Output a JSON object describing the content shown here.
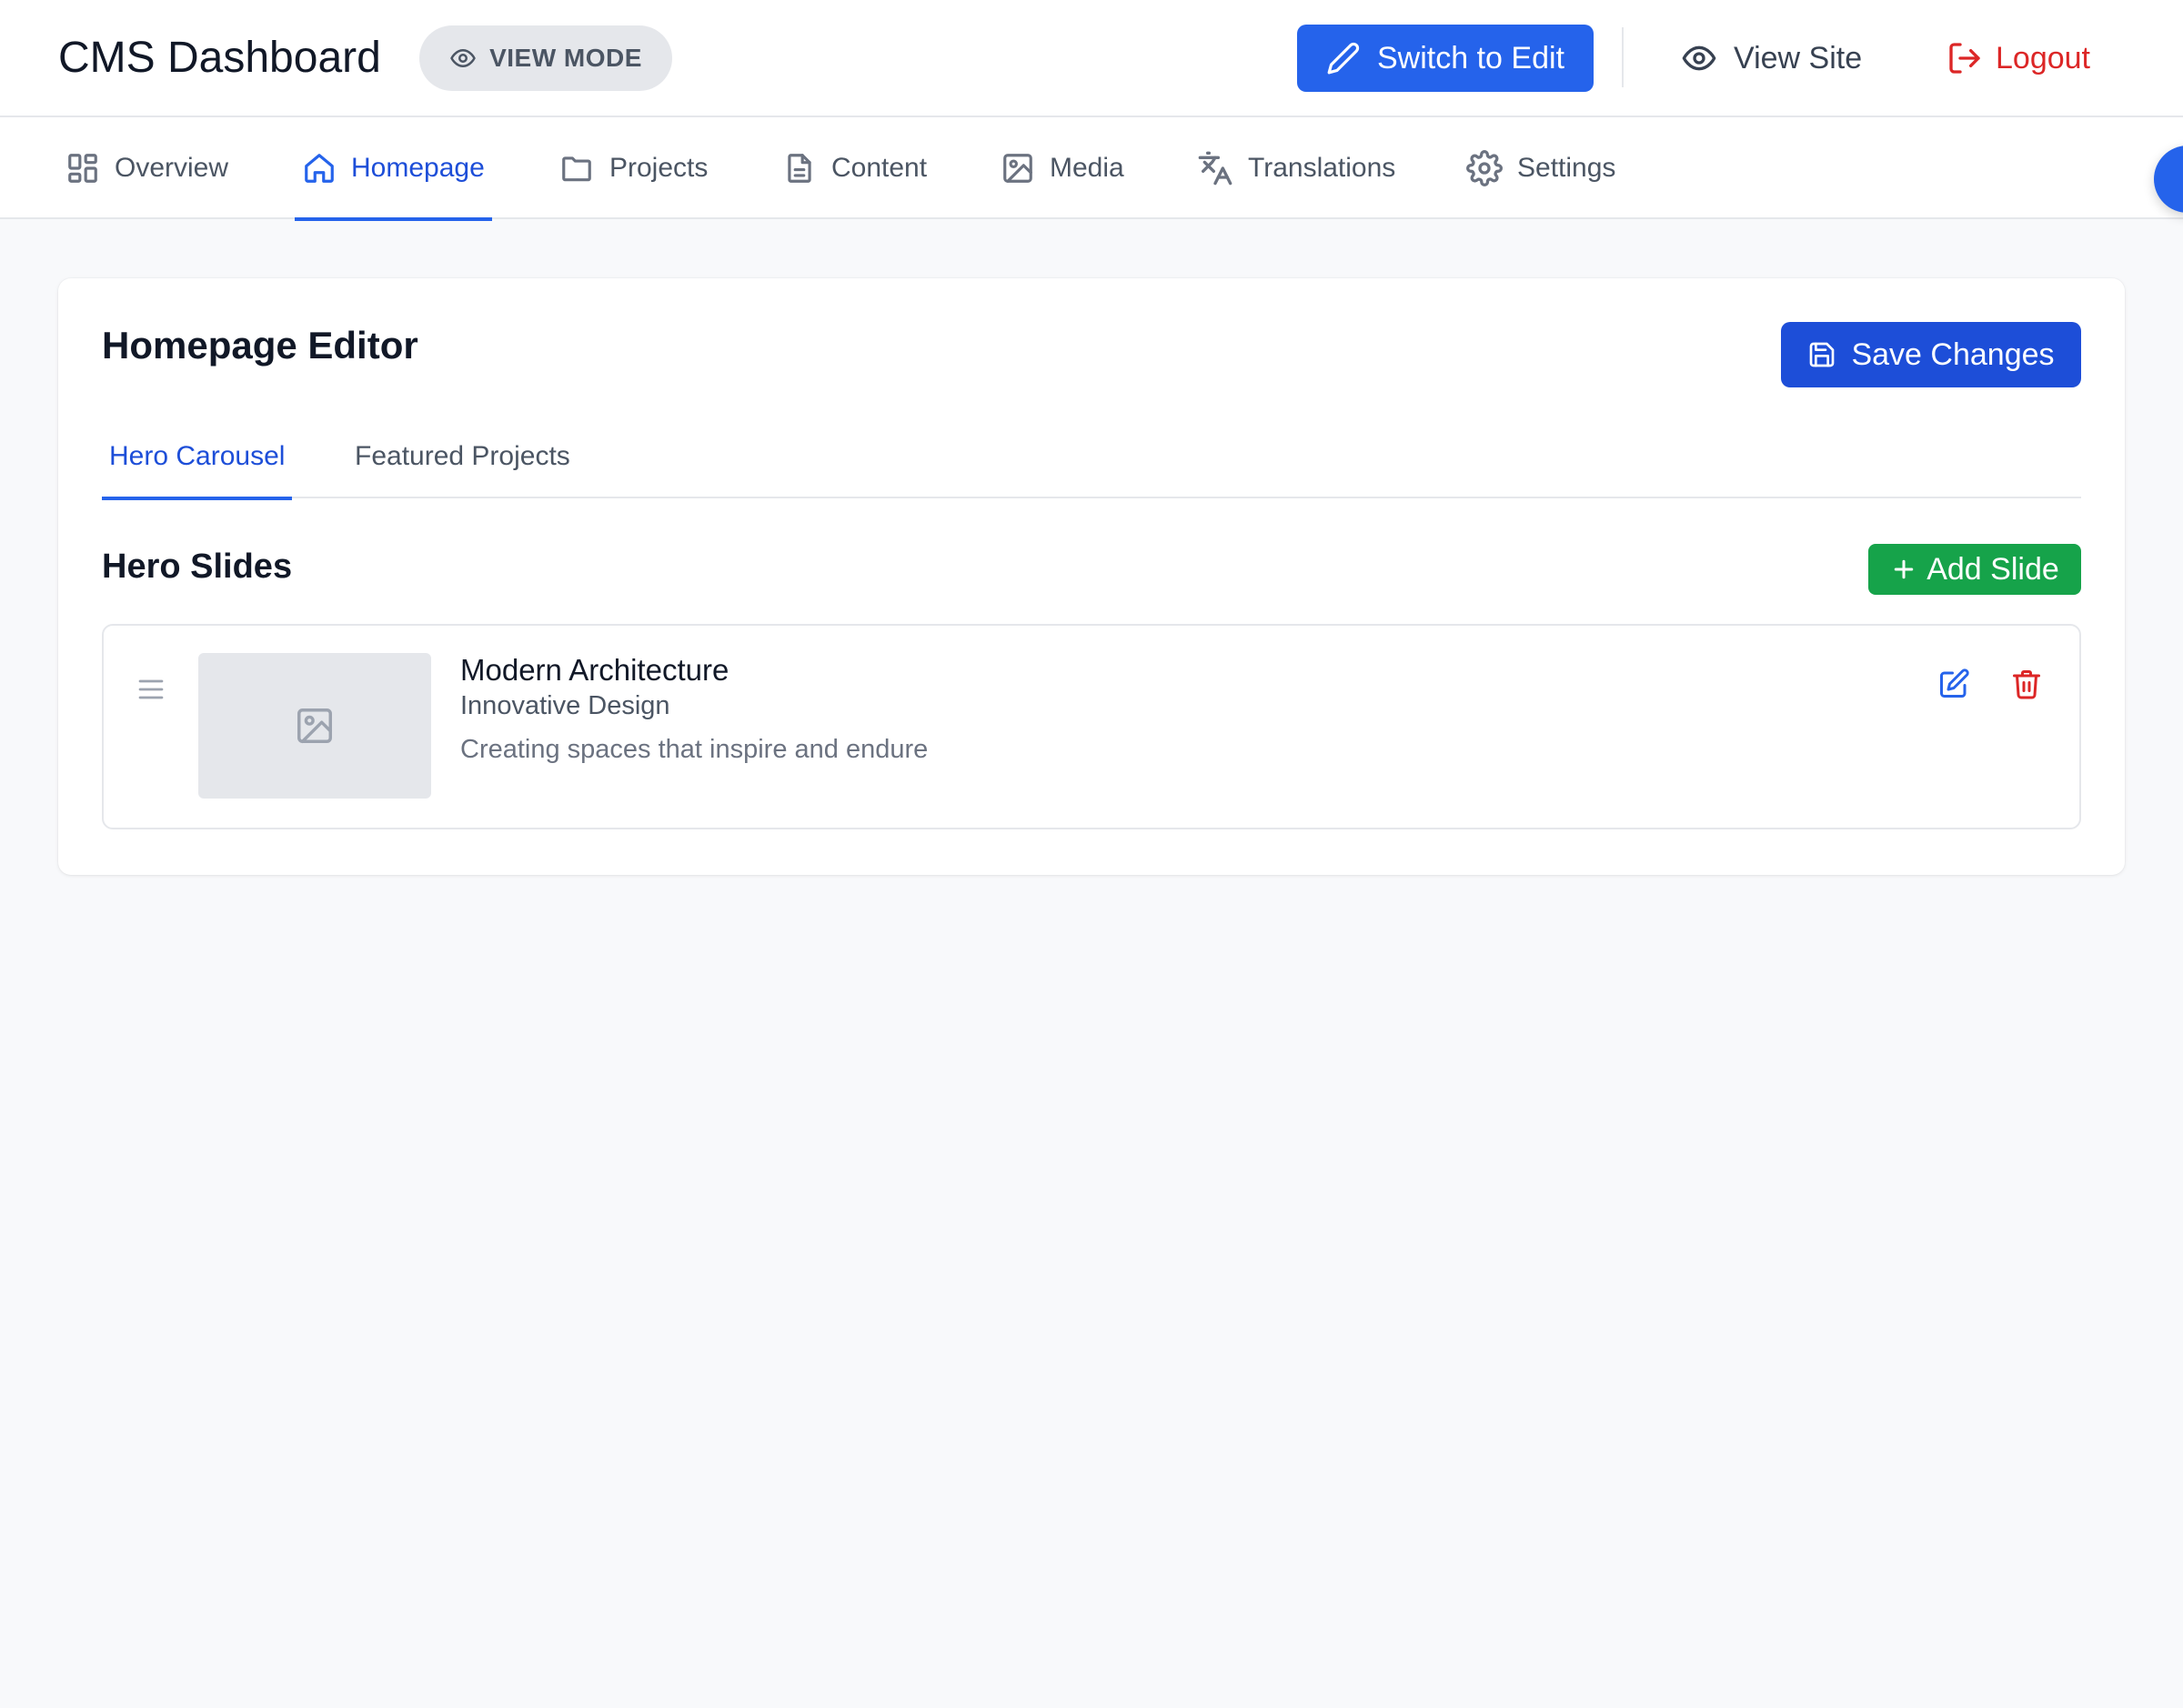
{
  "header": {
    "title": "CMS Dashboard",
    "mode_badge": "VIEW MODE",
    "switch_label": "Switch to Edit",
    "view_site_label": "View Site",
    "logout_label": "Logout"
  },
  "nav": {
    "items": [
      {
        "label": "Overview",
        "icon": "grid-icon"
      },
      {
        "label": "Homepage",
        "icon": "home-icon",
        "active": true
      },
      {
        "label": "Projects",
        "icon": "folder-icon"
      },
      {
        "label": "Content",
        "icon": "document-icon"
      },
      {
        "label": "Media",
        "icon": "image-icon"
      },
      {
        "label": "Translations",
        "icon": "translate-icon"
      },
      {
        "label": "Settings",
        "icon": "gear-icon"
      }
    ]
  },
  "editor": {
    "title": "Homepage Editor",
    "save_label": "Save Changes",
    "tabs": [
      {
        "label": "Hero Carousel",
        "active": true
      },
      {
        "label": "Featured Projects"
      }
    ],
    "section_title": "Hero Slides",
    "add_label": "Add Slide",
    "slides": [
      {
        "title": "Modern Architecture",
        "subtitle": "Innovative Design",
        "description": "Creating spaces that inspire and endure"
      }
    ]
  },
  "colors": {
    "primary": "#2563eb",
    "save": "#1d4ed8",
    "success": "#16a34a",
    "danger": "#dc2626",
    "background": "#f8f9fb"
  }
}
